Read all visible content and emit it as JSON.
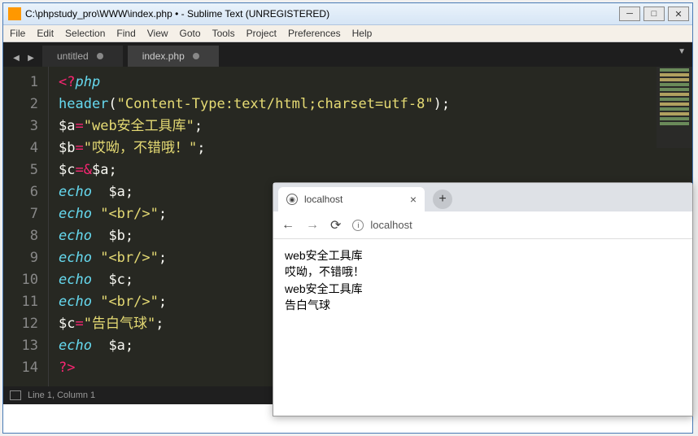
{
  "window": {
    "title": "C:\\phpstudy_pro\\WWW\\index.php • - Sublime Text (UNREGISTERED)"
  },
  "menu": {
    "items": [
      "File",
      "Edit",
      "Selection",
      "Find",
      "View",
      "Goto",
      "Tools",
      "Project",
      "Preferences",
      "Help"
    ]
  },
  "tabs": [
    {
      "label": "untitled",
      "active": false,
      "modified": true
    },
    {
      "label": "index.php",
      "active": true,
      "modified": true
    }
  ],
  "code": {
    "lines": [
      {
        "n": 1,
        "tokens": [
          [
            "op",
            "<?"
          ],
          [
            "kw",
            "php"
          ]
        ]
      },
      {
        "n": 2,
        "tokens": [
          [
            "fn",
            "header"
          ],
          [
            "punc",
            "("
          ],
          [
            "str",
            "\"Content-Type:text/html;charset=utf-8\""
          ],
          [
            "punc",
            ")"
          ],
          [
            "punc",
            ";"
          ]
        ]
      },
      {
        "n": 3,
        "tokens": [
          [
            "var",
            "$a"
          ],
          [
            "op",
            "="
          ],
          [
            "str",
            "\"web安全工具库\""
          ],
          [
            "punc",
            ";"
          ]
        ]
      },
      {
        "n": 4,
        "tokens": [
          [
            "var",
            "$b"
          ],
          [
            "op",
            "="
          ],
          [
            "str",
            "\"哎呦，不错哦！\""
          ],
          [
            "punc",
            ";"
          ]
        ]
      },
      {
        "n": 5,
        "tokens": [
          [
            "var",
            "$c"
          ],
          [
            "op",
            "="
          ],
          [
            "amp",
            "&"
          ],
          [
            "var",
            "$a"
          ],
          [
            "punc",
            ";"
          ]
        ]
      },
      {
        "n": 6,
        "tokens": [
          [
            "kw",
            "echo"
          ],
          [
            "punc",
            "  "
          ],
          [
            "var",
            "$a"
          ],
          [
            "punc",
            ";"
          ]
        ]
      },
      {
        "n": 7,
        "tokens": [
          [
            "kw",
            "echo"
          ],
          [
            "punc",
            " "
          ],
          [
            "str",
            "\"<br/>\""
          ],
          [
            "punc",
            ";"
          ]
        ]
      },
      {
        "n": 8,
        "tokens": [
          [
            "kw",
            "echo"
          ],
          [
            "punc",
            "  "
          ],
          [
            "var",
            "$b"
          ],
          [
            "punc",
            ";"
          ]
        ]
      },
      {
        "n": 9,
        "tokens": [
          [
            "kw",
            "echo"
          ],
          [
            "punc",
            " "
          ],
          [
            "str",
            "\"<br/>\""
          ],
          [
            "punc",
            ";"
          ]
        ]
      },
      {
        "n": 10,
        "tokens": [
          [
            "kw",
            "echo"
          ],
          [
            "punc",
            "  "
          ],
          [
            "var",
            "$c"
          ],
          [
            "punc",
            ";"
          ]
        ]
      },
      {
        "n": 11,
        "tokens": [
          [
            "kw",
            "echo"
          ],
          [
            "punc",
            " "
          ],
          [
            "str",
            "\"<br/>\""
          ],
          [
            "punc",
            ";"
          ]
        ]
      },
      {
        "n": 12,
        "tokens": [
          [
            "var",
            "$c"
          ],
          [
            "op",
            "="
          ],
          [
            "str",
            "\"告白气球\""
          ],
          [
            "punc",
            ";"
          ]
        ]
      },
      {
        "n": 13,
        "tokens": [
          [
            "kw",
            "echo"
          ],
          [
            "punc",
            "  "
          ],
          [
            "var",
            "$a"
          ],
          [
            "punc",
            ";"
          ]
        ]
      },
      {
        "n": 14,
        "tokens": [
          [
            "op",
            "?>"
          ]
        ]
      }
    ]
  },
  "status": {
    "text": "Line 1, Column 1"
  },
  "browser": {
    "tab_title": "localhost",
    "url": "localhost",
    "output": [
      "web安全工具库",
      "哎呦，不错哦！",
      "web安全工具库",
      "告白气球"
    ]
  }
}
